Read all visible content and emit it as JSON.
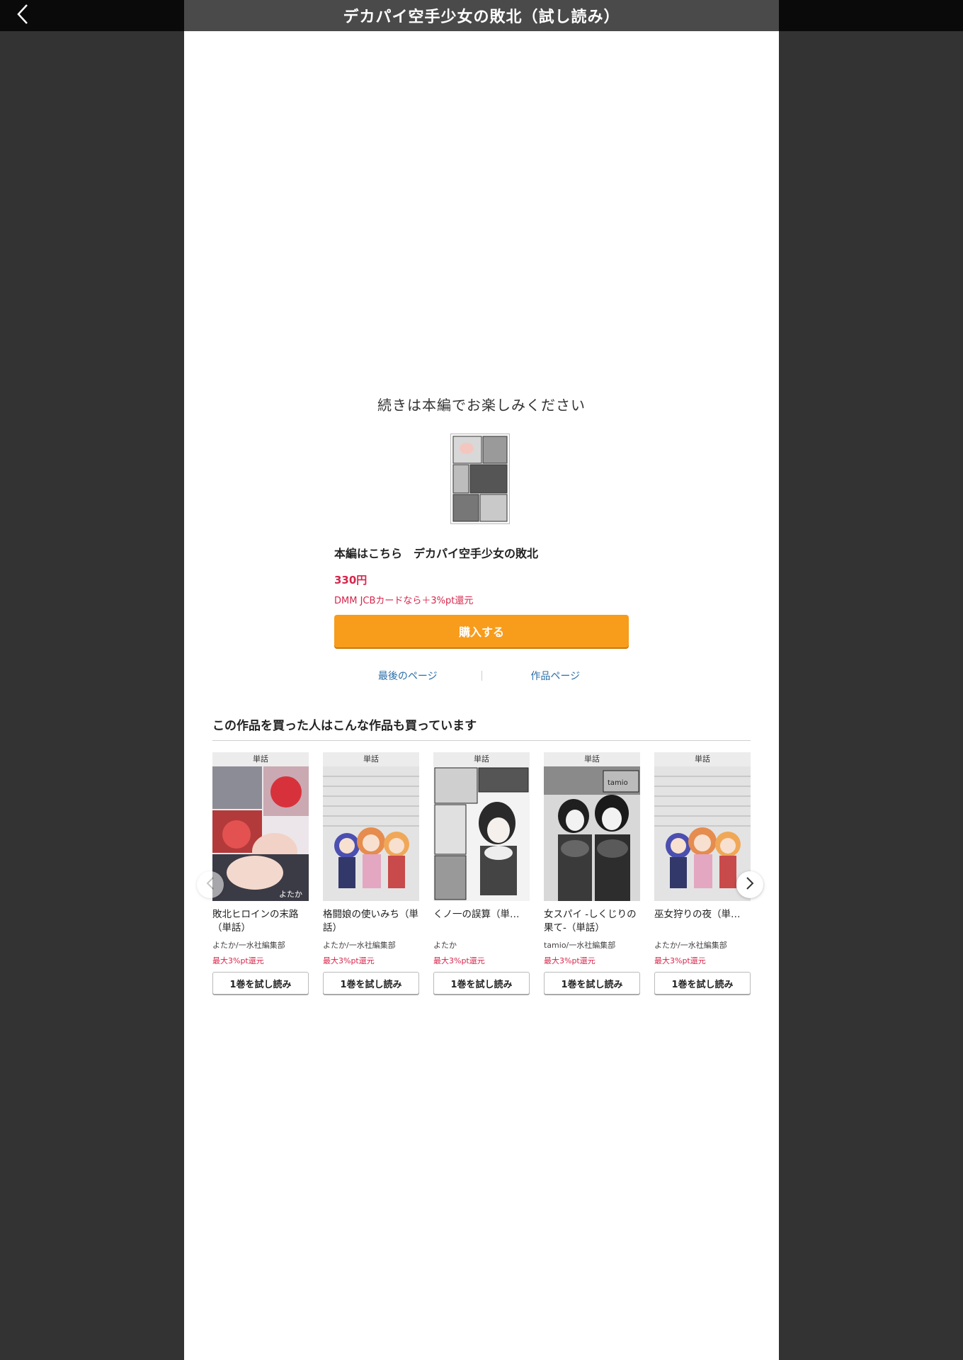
{
  "header": {
    "title": "デカパイ空手少女の敗北（試し読み）",
    "back_icon": "chevron-left-icon"
  },
  "end_screen": {
    "continue_message": "続きは本編でお楽しみください",
    "product_title": "本編はこちら　デカパイ空手少女の敗北",
    "price": "330円",
    "promo": "DMM JCBカードなら＋3%pt還元",
    "buy_label": "購入する",
    "last_page_label": "最後のページ",
    "work_page_label": "作品ページ"
  },
  "recommendations": {
    "heading": "この作品を買った人はこんな作品も買っています",
    "items": [
      {
        "badge": "単話",
        "title": "敗北ヒロインの末路（単話）",
        "author": "よたか/一水社編集部",
        "points": "最大3%pt還元",
        "trial_label": "1巻を試し読み"
      },
      {
        "badge": "単話",
        "title": "格闘娘の使いみち（単話）",
        "author": "よたか/一水社編集部",
        "points": "最大3%pt還元",
        "trial_label": "1巻を試し読み"
      },
      {
        "badge": "単話",
        "title": "くノ一の誤算（単…",
        "author": "よたか",
        "points": "最大3%pt還元",
        "trial_label": "1巻を試し読み"
      },
      {
        "badge": "単話",
        "title": "女スパイ -しくじりの果て-（単話）",
        "author": "tamio/一水社編集部",
        "points": "最大3%pt還元",
        "trial_label": "1巻を試し読み"
      },
      {
        "badge": "単話",
        "title": "巫女狩りの夜（単…",
        "author": "よたか/一水社編集部",
        "points": "最大3%pt還元",
        "trial_label": "1巻を試し読み"
      }
    ]
  },
  "colors": {
    "accent_orange": "#f89c1c",
    "price_red": "#d6264b",
    "link_blue": "#2a6ea8"
  }
}
